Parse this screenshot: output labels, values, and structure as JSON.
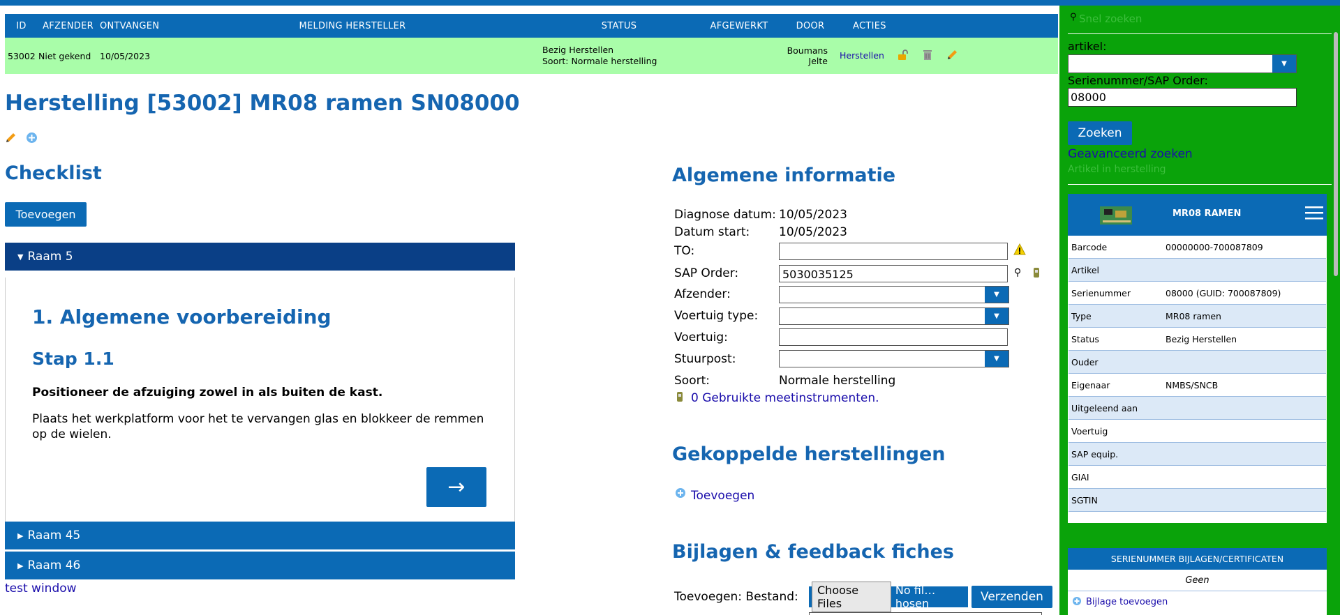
{
  "table": {
    "headers": [
      "ID",
      "AFZENDER",
      "ONTVANGEN",
      "MELDING HERSTELLER",
      "STATUS",
      "AFGEWERKT",
      "DOOR",
      "ACTIES"
    ],
    "row": {
      "id": "53002",
      "afzender": "Niet gekend",
      "ontvangen": "10/05/2023",
      "status_line1": "Bezig Herstellen",
      "status_line2": "Soort: Normale herstelling",
      "door": "Boumans Jelte",
      "actie_link": "Herstellen"
    }
  },
  "page_title": "Herstelling [53002] MR08 ramen SN08000",
  "checklist": {
    "title": "Checklist",
    "add_button": "Toevoegen",
    "sections": [
      {
        "label": "Raam 5",
        "expanded": true
      },
      {
        "label": "Raam 45",
        "expanded": false
      },
      {
        "label": "Raam 46",
        "expanded": false
      }
    ],
    "step": {
      "heading": "1. Algemene voorbereiding",
      "subheading": "Stap 1.1",
      "bold_text": "Positioneer de afzuiging zowel in als buiten de kast.",
      "body": "Plaats het werkplatform voor het te vervangen glas en blokkeer de remmen op de wielen.",
      "next_arrow": "→"
    },
    "test_link": "test window"
  },
  "info": {
    "title": "Algemene informatie",
    "diagnose_label": "Diagnose datum:",
    "diagnose_value": "10/05/2023",
    "start_label": "Datum start:",
    "start_value": "10/05/2023",
    "to_label": "TO:",
    "to_value": "",
    "sap_label": "SAP Order:",
    "sap_value": "5030035125",
    "afzender_label": "Afzender:",
    "voertuig_type_label": "Voertuig type:",
    "voertuig_label": "Voertuig:",
    "stuurpost_label": "Stuurpost:",
    "soort_label": "Soort:",
    "soort_value": "Normale herstelling",
    "meet_link": "0 Gebruikte meetinstrumenten."
  },
  "gekoppelde": {
    "title": "Gekoppelde herstellingen",
    "add_link": "Toevoegen"
  },
  "bijlagen": {
    "title": "Bijlagen & feedback fiches",
    "toevoegen_label": "Toevoegen: Bestand:",
    "choose_files": "Choose Files",
    "no_file": "No fil…hosen",
    "send_button": "Verzenden"
  },
  "sidebar": {
    "search_placeholder": "Snel zoeken",
    "artikel_label": "artikel:",
    "serial_label": "Serienummer/SAP Order:",
    "serial_value": "08000",
    "search_button": "Zoeken",
    "advanced_link": "Geavanceerd zoeken",
    "artikel_link": "Artikel in herstelling",
    "card": {
      "title": "MR08 RAMEN",
      "rows": [
        {
          "label": "Barcode",
          "value": "00000000-700087809"
        },
        {
          "label": "Artikel",
          "value": ""
        },
        {
          "label": "Serienummer",
          "value": "08000 (GUID: 700087809)"
        },
        {
          "label": "Type",
          "value": "MR08 ramen"
        },
        {
          "label": "Status",
          "value": "Bezig Herstellen"
        },
        {
          "label": "Ouder",
          "value": ""
        },
        {
          "label": "Eigenaar",
          "value": "NMBS/SNCB"
        },
        {
          "label": "Uitgeleend aan",
          "value": ""
        },
        {
          "label": "Voertuig",
          "value": ""
        },
        {
          "label": "SAP equip.",
          "value": ""
        },
        {
          "label": "GIAI",
          "value": ""
        },
        {
          "label": "SGTIN",
          "value": ""
        }
      ]
    },
    "bijlagen_header": "SERIENUMMER BIJLAGEN/CERTIFICATEN",
    "bijlagen_geen": "Geen",
    "bijlage_link": "Bijlage toevoegen"
  },
  "colors": {
    "accent": "#0b6ab5",
    "row_bg": "#a9fda9",
    "sidebar_bg": "#0aa30a",
    "dark_header": "#0a3f86"
  }
}
